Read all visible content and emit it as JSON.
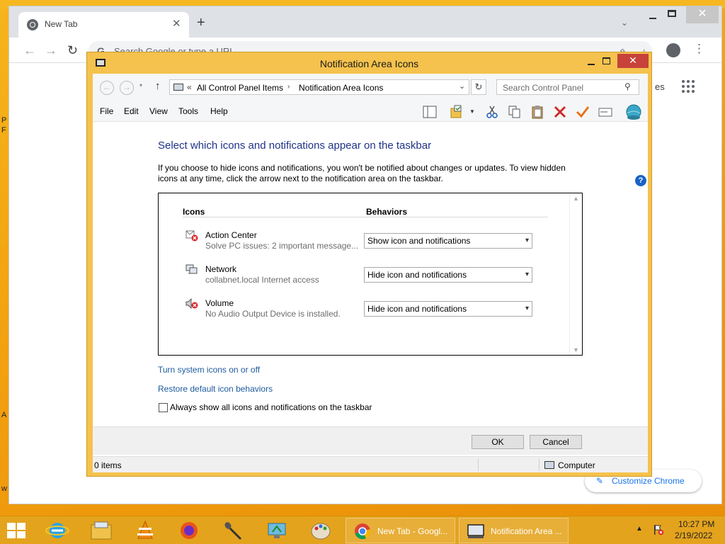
{
  "chrome": {
    "tab_title": "New Tab",
    "tab_close": "✕",
    "new_tab": "+",
    "tab_search": "⌄",
    "window_close": "✕",
    "back": "←",
    "forward": "→",
    "reload": "↻",
    "omnibox_g": "G",
    "omnibox_placeholder": "Search Google or type a URL",
    "share": "⇪",
    "star": "☆",
    "kebab": "⋮",
    "partial_label": "es",
    "customize_label": "Customize Chrome",
    "customize_icon": "✎",
    "left_letters": [
      "P",
      "F",
      "A",
      "w"
    ]
  },
  "explorer": {
    "title": "Notification Area Icons",
    "close": "✕",
    "back": "←",
    "forward": "→",
    "dropdown": "▾",
    "up": "↑",
    "address": {
      "chevron": "«",
      "crumbs": [
        "All Control Panel Items",
        "Notification Area Icons"
      ],
      "separator": "›",
      "dropdown": "⌄"
    },
    "refresh": "↻",
    "search_placeholder": "Search Control Panel",
    "search_icon": "⚲",
    "menu": [
      "File",
      "Edit",
      "View",
      "Tools",
      "Help"
    ],
    "help": "?",
    "heading": "Select which icons and notifications appear on the taskbar",
    "description": "If you choose to hide icons and notifications, you won't be notified about changes or updates. To view hidden icons at any time, click the arrow next to the notification area on the taskbar.",
    "columns": {
      "icons": "Icons",
      "behaviors": "Behaviors"
    },
    "rows": [
      {
        "name": "Action Center",
        "sub": "Solve PC issues: 2 important message...",
        "behavior": "Show icon and notifications",
        "icon": "action-center-icon"
      },
      {
        "name": "Network",
        "sub": "collabnet.local Internet access",
        "behavior": "Hide icon and notifications",
        "icon": "network-icon"
      },
      {
        "name": "Volume",
        "sub": "No Audio Output Device is installed.",
        "behavior": "Hide icon and notifications",
        "icon": "volume-icon"
      }
    ],
    "select_arrow": "▾",
    "scroll_up": "▲",
    "scroll_down": "▼",
    "links": {
      "system_icons": "Turn system icons on or off",
      "restore": "Restore default icon behaviors"
    },
    "always_show": "Always show all icons and notifications on the taskbar",
    "ok": "OK",
    "cancel": "Cancel",
    "status_items": "0 items",
    "status_computer": "Computer"
  },
  "taskbar": {
    "tasks": [
      {
        "label": "New Tab - Googl..."
      },
      {
        "label": "Notification Area ..."
      }
    ],
    "tray_up": "▲",
    "time": "10:27 PM",
    "date": "2/19/2022"
  },
  "colors": {
    "desktop": "#f2a10f",
    "window_frame": "#f5c24d",
    "title_close": "#c7423a",
    "link": "#1e5a9e",
    "heading": "#1e3287"
  }
}
